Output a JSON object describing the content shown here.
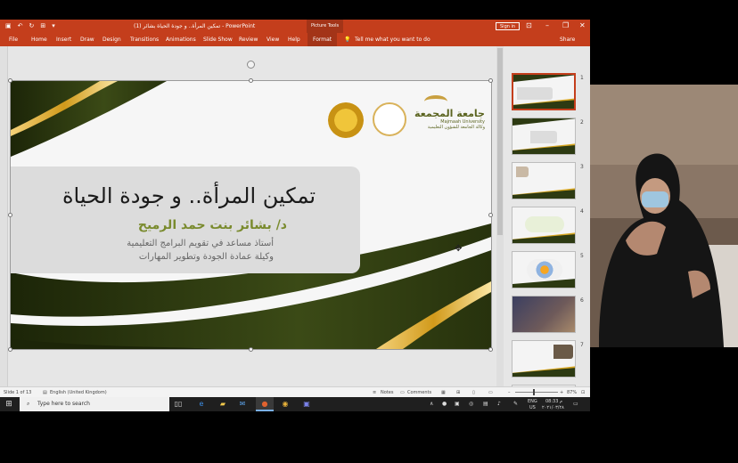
{
  "window": {
    "title": "تمكين المرأة.. و جودة الحياة بشائر (1)  -  PowerPoint",
    "tool_tab": "Picture Tools",
    "sign_in": "Sign in",
    "qa_icons": [
      "save-icon",
      "undo-icon",
      "redo-icon",
      "present-icon",
      "customize-icon"
    ]
  },
  "menu": {
    "items": [
      "File",
      "Home",
      "Insert",
      "Draw",
      "Design",
      "Transitions",
      "Animations",
      "Slide Show",
      "Review",
      "View",
      "Help"
    ],
    "format": "Format",
    "tell_me": "Tell me what you want to do",
    "share": "Share"
  },
  "slide": {
    "title": "تمكين المرأة.. و جودة الحياة",
    "presenter": "د/ بشائر بنت حمد الرميح",
    "role_line1": "أستاذ مساعد في تقويم البرامج التعليمية",
    "role_line2": "وكيلة عمادة الجودة وتطوير المهارات",
    "logo_ar": "جامعة المجمعة",
    "logo_en": "Majmaah University",
    "logo_ar2": "وكالة الجامعة للشؤون التعليمية",
    "colors": {
      "dark_band": "#2d3a12",
      "gold": "#d6a520",
      "green_text": "#7a8b2e"
    }
  },
  "thumbnails": {
    "numbers": [
      "1",
      "2",
      "3",
      "4",
      "5",
      "6",
      "7",
      "8"
    ],
    "selected": 1
  },
  "status": {
    "slide_of": "Slide 1 of 13",
    "language": "English (United Kingdom)",
    "notes": "Notes",
    "comments": "Comments",
    "zoom": "87%"
  },
  "taskbar": {
    "search_placeholder": "Type here to search",
    "lang1": "ENG",
    "lang2": "US",
    "time": "08:33 م",
    "date": "٢٠٢١/٠٣/٢٨"
  }
}
